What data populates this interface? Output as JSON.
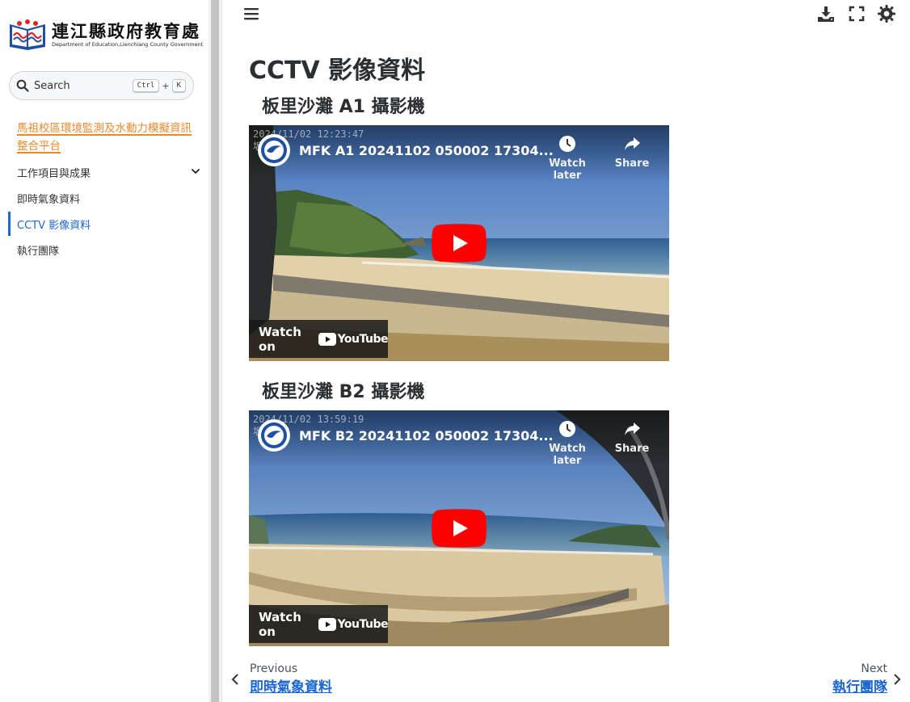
{
  "sidebar": {
    "logo_title": "連江縣政府教育處",
    "logo_subtitle": "Department of Education,Lienchiang County Government",
    "search_label": "Search",
    "search_kbd1": "Ctrl",
    "search_kbd_plus": "+",
    "search_kbd2": "K",
    "site_link": "馬祖校區環境監測及水動力模擬資訊整合平台",
    "items": [
      {
        "label": "工作項目與成果"
      },
      {
        "label": "即時氣象資料"
      },
      {
        "label": "CCTV 影像資料"
      },
      {
        "label": "執行團隊"
      }
    ]
  },
  "header": {
    "icons": [
      "menu-icon",
      "download-icon",
      "fullscreen-icon",
      "theme-icon"
    ]
  },
  "main": {
    "title": "CCTV 影像資料",
    "cameras": [
      {
        "heading": "板里沙灘 A1 攝影機",
        "timestamp": "2024/11/02 12:23:47",
        "overlay_code": "坂里 A1",
        "video_title": "MFK A1 20241102 050002 17304...",
        "watch_later": "Watch later",
        "share": "Share",
        "watch_on": "Watch on",
        "youtube": "YouTube"
      },
      {
        "heading": "板里沙灘 B2 攝影機",
        "timestamp": "2024/11/02 13:59:19",
        "overlay_code": "坂里 B2",
        "video_title": "MFK B2 20241102 050002 17304...",
        "watch_later": "Watch later",
        "share": "Share",
        "watch_on": "Watch on",
        "youtube": "YouTube"
      }
    ]
  },
  "footer": {
    "prev_label": "Previous",
    "prev_link": "即時氣象資料",
    "next_label": "Next",
    "next_link": "執行團隊"
  },
  "colors": {
    "accent": "#1a66d2",
    "site_link": "#e8892b",
    "youtube_red": "#ff0000"
  }
}
